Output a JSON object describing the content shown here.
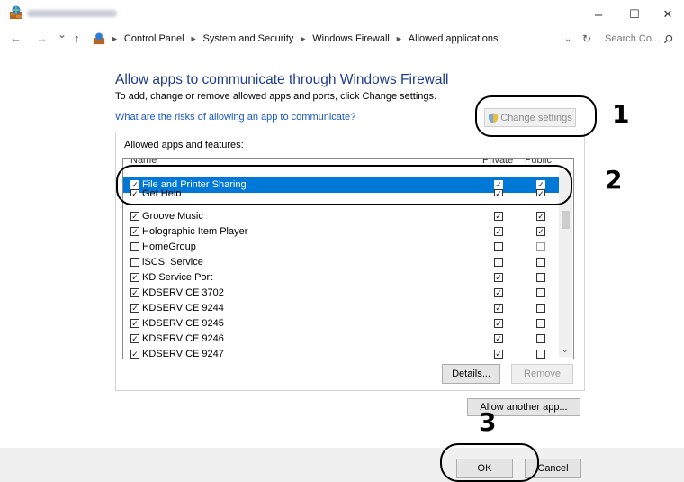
{
  "window": {
    "minimize": "–",
    "maximize": "☐",
    "close": "✕"
  },
  "nav": {
    "back": "←",
    "forward": "→",
    "recent": "⌄",
    "up": "↑"
  },
  "breadcrumb": [
    "Control Panel",
    "System and Security",
    "Windows Firewall",
    "Allowed applications"
  ],
  "search": {
    "placeholder": "Search Co..."
  },
  "main": {
    "heading": "Allow apps to communicate through Windows Firewall",
    "subtext": "To add, change or remove allowed apps and ports, click Change settings.",
    "risk_link": "What are the risks of allowing an app to communicate?",
    "change_settings": "Change settings",
    "group_label": "Allowed apps and features:",
    "columns": {
      "name": "Name",
      "private": "Private",
      "public": "Public"
    },
    "apps": [
      {
        "name": "File and Printer Sharing",
        "checked": true,
        "private": true,
        "public": true,
        "selected": true
      },
      {
        "name": "Get Help",
        "checked": true,
        "private": true,
        "public": true
      },
      {
        "name": "Groove Music",
        "checked": true,
        "private": true,
        "public": true
      },
      {
        "name": "Holographic Item Player",
        "checked": true,
        "private": true,
        "public": true
      },
      {
        "name": "HomeGroup",
        "checked": false,
        "private": false,
        "public": false,
        "public_dim": true
      },
      {
        "name": "iSCSI Service",
        "checked": false,
        "private": false,
        "public": false
      },
      {
        "name": "KD Service Port",
        "checked": true,
        "private": true,
        "public": false
      },
      {
        "name": "KDSERVICE 3702",
        "checked": true,
        "private": true,
        "public": false
      },
      {
        "name": "KDSERVICE 9244",
        "checked": true,
        "private": true,
        "public": false
      },
      {
        "name": "KDSERVICE 9245",
        "checked": true,
        "private": true,
        "public": false
      },
      {
        "name": "KDSERVICE 9246",
        "checked": true,
        "private": true,
        "public": false
      },
      {
        "name": "KDSERVICE 9247",
        "checked": true,
        "private": true,
        "public": false
      }
    ],
    "details": "Details...",
    "remove": "Remove",
    "allow_another": "Allow another app..."
  },
  "footer": {
    "ok": "OK",
    "cancel": "Cancel"
  },
  "callouts": {
    "one": "1",
    "two": "2",
    "three": "3"
  }
}
